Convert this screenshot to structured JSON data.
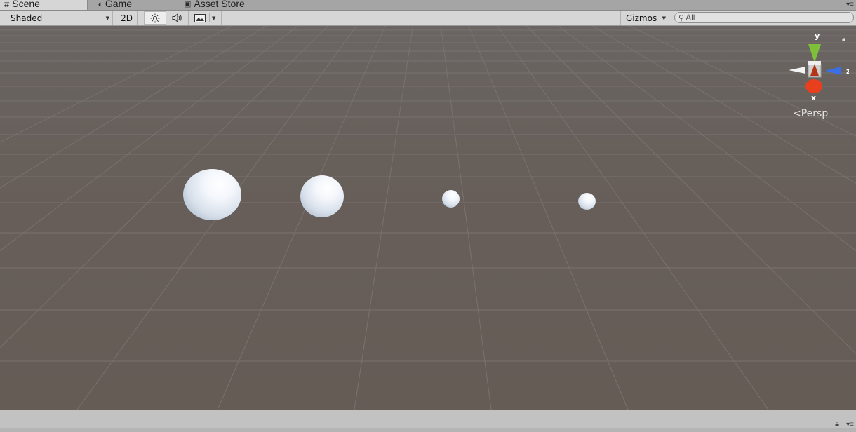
{
  "tabs": [
    {
      "label": "Scene",
      "icon": "grid-hash-icon",
      "glyph": "#"
    },
    {
      "label": "Game",
      "icon": "pacman-icon",
      "glyph": "◖"
    },
    {
      "label": "Asset Store",
      "icon": "shopping-bag-icon",
      "glyph": "🛍"
    }
  ],
  "toolbar": {
    "shading_mode": "Shaded",
    "mode_2d": "2D",
    "gizmos_label": "Gizmos",
    "search_value": "All"
  },
  "viewport": {
    "projection_label": "Persp",
    "axes": {
      "y": "y",
      "x": "x",
      "z": "z"
    },
    "colors": {
      "y_axis": "#7ec03a",
      "x_axis": "#e8401e",
      "z_axis": "#3a6fe8"
    }
  }
}
